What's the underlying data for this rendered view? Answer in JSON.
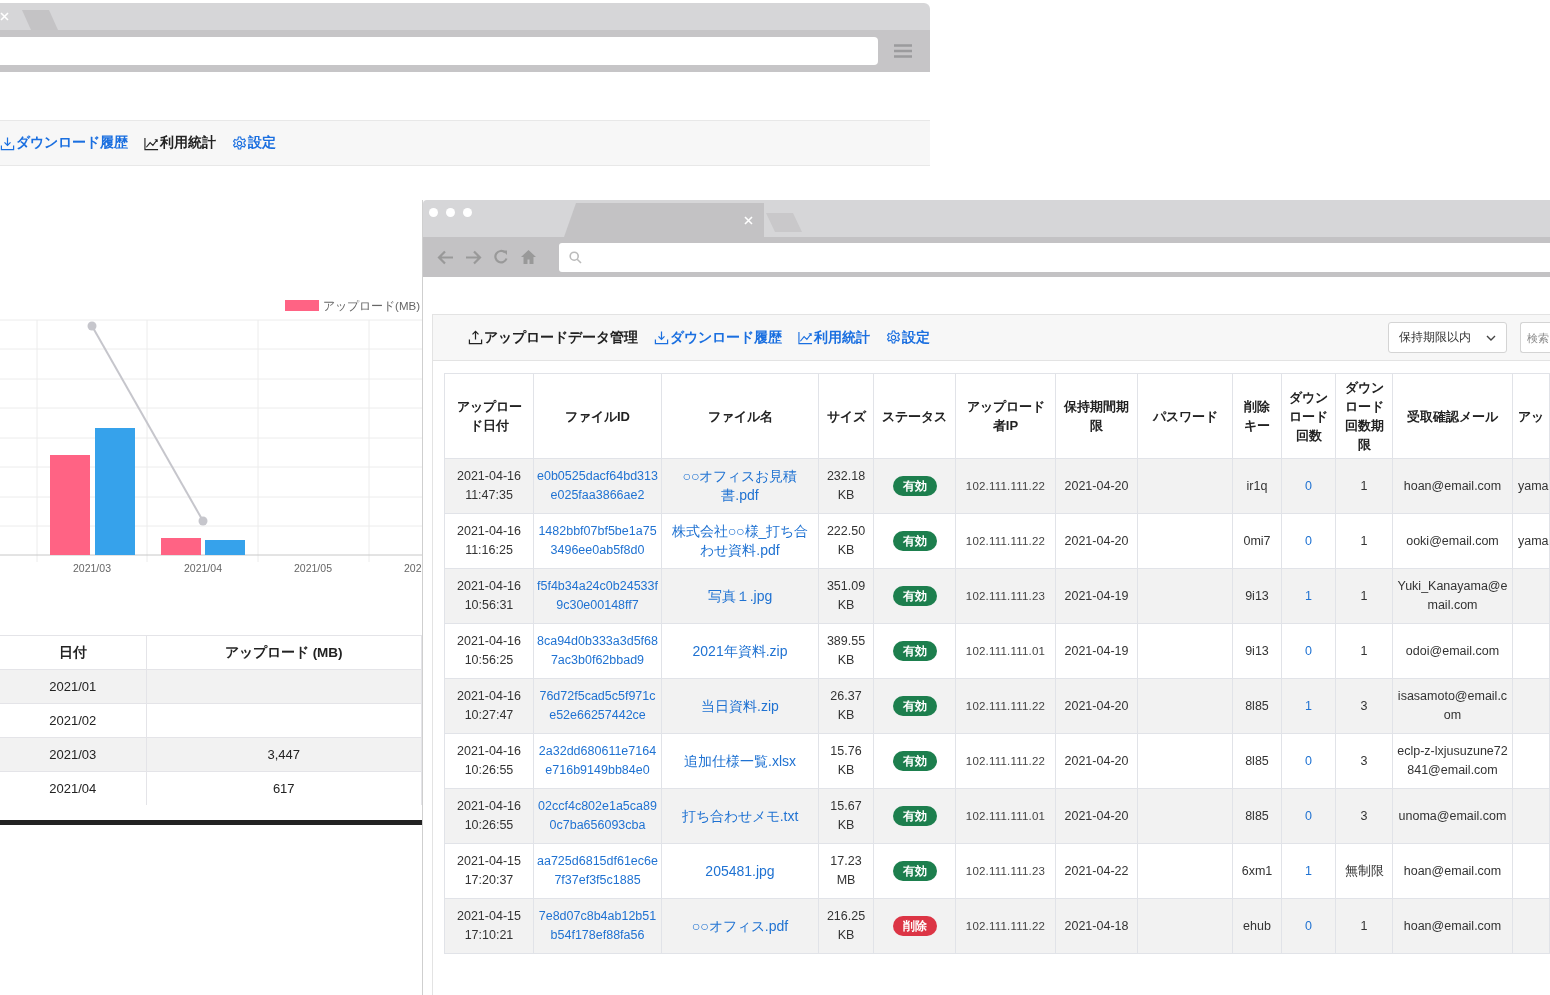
{
  "back_window": {
    "nav": [
      {
        "label": "ダウンロード履歴",
        "selected": false
      },
      {
        "label": "利用統計",
        "selected": true
      },
      {
        "label": "設定",
        "selected": false
      }
    ],
    "chart": {
      "legend": "アップロード(MB)",
      "x_labels": [
        "2021/03",
        "2021/04",
        "2021/05",
        "202"
      ]
    },
    "table": {
      "columns": [
        "日付",
        "アップロード (MB)"
      ],
      "rows": [
        {
          "date": "2021/01"
        },
        {
          "date": "2021/02"
        },
        {
          "date": "2021/03",
          "upload": "3,447"
        },
        {
          "date": "2021/04",
          "upload": "617"
        }
      ]
    }
  },
  "front_window": {
    "nav": [
      {
        "label": "アップロードデータ管理",
        "selected": true
      },
      {
        "label": "ダウンロード履歴",
        "selected": false
      },
      {
        "label": "利用統計",
        "selected": false
      },
      {
        "label": "設定",
        "selected": false
      }
    ],
    "filter": {
      "value": "保持期限以内"
    },
    "search": {
      "placeholder": "検索"
    },
    "table": {
      "columns": [
        "アップロード日付",
        "ファイルID",
        "ファイル名",
        "サイズ",
        "ステータス",
        "アップロード者IP",
        "保持期間期限",
        "パスワード",
        "削除キー",
        "ダウンロード回数",
        "ダウンロード回数期限",
        "受取確認メール",
        "アッ"
      ],
      "rows": [
        {
          "date": "2021-04-16 11:47:35",
          "file_id": "e0b0525dacf64bd313e025faa3866ae2",
          "file_name": "○○オフィスお見積書.pdf",
          "size": "232.18 KB",
          "status": {
            "label": "有効",
            "kind": "valid"
          },
          "ip": "102.111.111.22",
          "expiry": "2021-04-20",
          "delete_key": "ir1q",
          "downloads": "0",
          "download_limit": "1",
          "email": "hoan@email.com",
          "column_13": "yama"
        },
        {
          "date": "2021-04-16 11:16:25",
          "file_id": "1482bbf07bf5be1a753496ee0ab5f8d0",
          "file_name": "株式会社○○様_打ち合わせ資料.pdf",
          "size": "222.50 KB",
          "status": {
            "label": "有効",
            "kind": "valid"
          },
          "ip": "102.111.111.22",
          "expiry": "2021-04-20",
          "delete_key": "0mi7",
          "downloads": "0",
          "download_limit": "1",
          "email": "ooki@email.com",
          "column_13": "yama"
        },
        {
          "date": "2021-04-16 10:56:31",
          "file_id": "f5f4b34a24c0b24533f9c30e00148ff7",
          "file_name": "写真１.jpg",
          "size": "351.09 KB",
          "status": {
            "label": "有効",
            "kind": "valid"
          },
          "ip": "102.111.111.23",
          "expiry": "2021-04-19",
          "delete_key": "9i13",
          "downloads": "1",
          "download_limit": "1",
          "email": "Yuki_Kanayama@email.com"
        },
        {
          "date": "2021-04-16 10:56:25",
          "file_id": "8ca94d0b333a3d5f687ac3b0f62bbad9",
          "file_name": "2021年資料.zip",
          "size": "389.55 KB",
          "status": {
            "label": "有効",
            "kind": "valid"
          },
          "ip": "102.111.111.01",
          "expiry": "2021-04-19",
          "delete_key": "9i13",
          "downloads": "0",
          "download_limit": "1",
          "email": "odoi@email.com"
        },
        {
          "date": "2021-04-16 10:27:47",
          "file_id": "76d72f5cad5c5f971ce52e66257442ce",
          "file_name": "当日資料.zip",
          "size": "26.37 KB",
          "status": {
            "label": "有効",
            "kind": "valid"
          },
          "ip": "102.111.111.22",
          "expiry": "2021-04-20",
          "delete_key": "8l85",
          "downloads": "1",
          "download_limit": "3",
          "email": "isasamoto@email.com"
        },
        {
          "date": "2021-04-16 10:26:55",
          "file_id": "2a32dd680611e7164e716b9149bb84e0",
          "file_name": "追加仕様一覧.xlsx",
          "size": "15.76 KB",
          "status": {
            "label": "有効",
            "kind": "valid"
          },
          "ip": "102.111.111.22",
          "expiry": "2021-04-20",
          "delete_key": "8l85",
          "downloads": "0",
          "download_limit": "3",
          "email": "eclp-z-lxjusuzune72841@email.com"
        },
        {
          "date": "2021-04-16 10:26:55",
          "file_id": "02ccf4c802e1a5ca890c7ba656093cba",
          "file_name": "打ち合わせメモ.txt",
          "size": "15.67 KB",
          "status": {
            "label": "有効",
            "kind": "valid"
          },
          "ip": "102.111.111.01",
          "expiry": "2021-04-20",
          "delete_key": "8l85",
          "downloads": "0",
          "download_limit": "3",
          "email": "unoma@email.com"
        },
        {
          "date": "2021-04-15 17:20:37",
          "file_id": "aa725d6815df61ec6e7f37ef3f5c1885",
          "file_name": "205481.jpg",
          "size": "17.23 MB",
          "status": {
            "label": "有効",
            "kind": "valid"
          },
          "ip": "102.111.111.23",
          "expiry": "2021-04-22",
          "delete_key": "6xm1",
          "downloads": "1",
          "download_limit": "無制限",
          "email": "hoan@email.com"
        },
        {
          "date": "2021-04-15 17:10:21",
          "file_id": "7e8d07c8b4ab12b51b54f178ef88fa56",
          "file_name": "○○オフィス.pdf",
          "size": "216.25 KB",
          "status": {
            "label": "削除",
            "kind": "deleted"
          },
          "ip": "102.111.111.22",
          "expiry": "2021-04-18",
          "delete_key": "ehub",
          "downloads": "0",
          "download_limit": "1",
          "email": "hoan@email.com"
        }
      ]
    }
  }
}
